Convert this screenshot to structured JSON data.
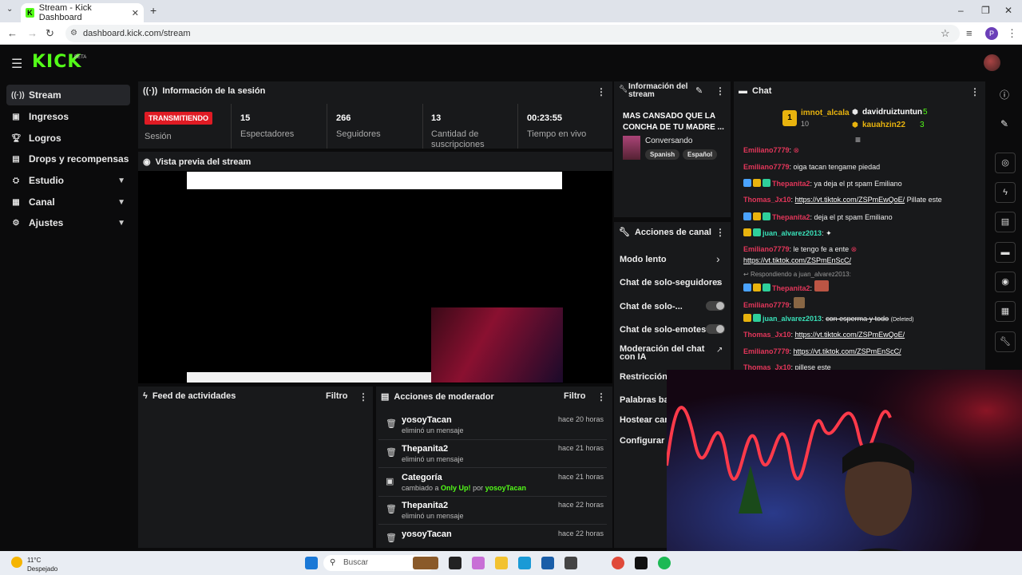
{
  "browser": {
    "tab_title": "Stream - Kick Dashboard",
    "url": "dashboard.kick.com/stream",
    "profile_initial": "P"
  },
  "kick": {
    "logo": "KICK",
    "beta": "BETA"
  },
  "sidebar": {
    "items": [
      {
        "label": "Stream",
        "icon": "broadcast-icon"
      },
      {
        "label": "Ingresos",
        "icon": "wallet-icon"
      },
      {
        "label": "Logros",
        "icon": "trophy-icon"
      },
      {
        "label": "Drops y recompensas",
        "icon": "gift-icon"
      },
      {
        "label": "Estudio",
        "icon": "studio-icon"
      },
      {
        "label": "Canal",
        "icon": "channel-icon"
      },
      {
        "label": "Ajustes",
        "icon": "gear-icon"
      }
    ]
  },
  "session": {
    "title": "Información de la sesión",
    "status": "TRANSMITIENDO",
    "status_label": "Sesión",
    "stats": [
      {
        "value": "15",
        "label": "Espectadores"
      },
      {
        "value": "266",
        "label": "Seguidores"
      },
      {
        "value": "13",
        "label": "Cantidad de suscripciones"
      },
      {
        "value": "00:23:55",
        "label": "Tiempo en vivo"
      }
    ]
  },
  "preview": {
    "title": "Vista previa del stream"
  },
  "stream_info": {
    "title": "Información del stream",
    "stream_title": "MAS CANSADO QUE LA CONCHA DE TU MADRE ...",
    "category": "Conversando",
    "tags": [
      "Spanish",
      "Español"
    ]
  },
  "channel_actions": {
    "title": "Acciones de canal",
    "items": [
      "Modo lento",
      "Chat de solo-seguidores",
      "Chat de solo-...",
      "Chat de solo-emotes",
      "Moderación del chat con IA",
      "Restricción d",
      "Palabras ban",
      "Hostear cana",
      "Configurar ol"
    ]
  },
  "activity": {
    "title": "Feed de actividades",
    "filter": "Filtro"
  },
  "moderator": {
    "title": "Acciones de moderador",
    "filter": "Filtro",
    "items": [
      {
        "name": "yosoyTacan",
        "action": "eliminó un mensaje",
        "time": "hace 20 horas"
      },
      {
        "name": "Thepanita2",
        "action": "eliminó un mensaje",
        "time": "hace 21 horas"
      },
      {
        "name": "Categoría",
        "action_prefix": "cambiado a",
        "action_value": "Only Up!",
        "action_by": "por",
        "action_user": "yosoyTacan",
        "time": "hace 21 horas"
      },
      {
        "name": "Thepanita2",
        "action": "eliminó un mensaje",
        "time": "hace 22 horas"
      },
      {
        "name": "yosoyTacan",
        "action": "",
        "time": "hace 22 horas"
      }
    ]
  },
  "chat": {
    "title": "Chat",
    "leaders": [
      {
        "rank": "1",
        "name": "imnot_alcala",
        "count": "10"
      },
      {
        "name": "davidruiztuntun",
        "count": "5"
      },
      {
        "name": "kauahzin22",
        "count": "3"
      }
    ],
    "messages": [
      {
        "user": "Emiliano7779",
        "text": ""
      },
      {
        "user": "Emiliano7779",
        "text": "oiga tacan tengame piedad"
      },
      {
        "user": "Thepanita2",
        "text": "ya deja el pt spam Emiliano"
      },
      {
        "user": "Thomas_Jx10",
        "link": "https://vt.tiktok.com/ZSPmEwQoE/",
        "text": "Pillate este"
      },
      {
        "user": "Thepanita2",
        "text": "deja el pt spam Emiliano"
      },
      {
        "user": "juan_alvarez2013",
        "text": ""
      },
      {
        "user": "Emiliano7779",
        "text": "le tengo fe a ente"
      },
      {
        "user": "",
        "link": "https://vt.tiktok.com/ZSPmEnScC/",
        "text": ""
      },
      {
        "reply": "Respondiendo a juan_alvarez2013:"
      },
      {
        "user": "Thepanita2",
        "text": ""
      },
      {
        "user": "Emiliano7779",
        "text": ""
      },
      {
        "user": "juan_alvarez2013",
        "text": "con esperma y todo",
        "deleted": "(Deleted)"
      },
      {
        "user": "Thomas_Jx10",
        "link": "https://vt.tiktok.com/ZSPmEwQoE/",
        "text": ""
      },
      {
        "user": "Emiliano7779",
        "link": "https://vt.tiktok.com/ZSPmEnScC/",
        "text": ""
      },
      {
        "user": "Thomas_Jx10",
        "text": "pillese este"
      }
    ]
  },
  "taskbar": {
    "temp": "11°C",
    "weather": "Despejado",
    "search": "Buscar"
  },
  "colors": {
    "accent": "#53fc18",
    "live": "#e01b24",
    "panel": "#18191b"
  }
}
